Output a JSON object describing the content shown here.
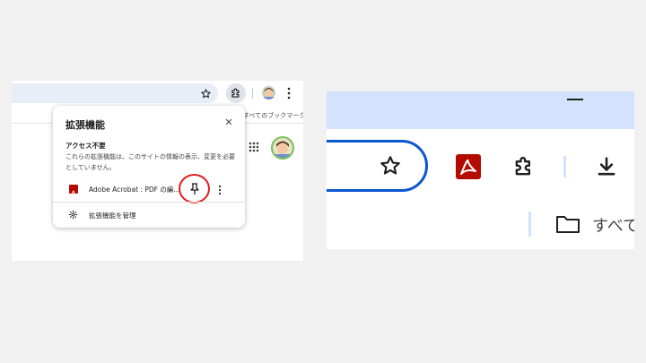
{
  "left_panel": {
    "bookmarks_bar_text": "すべてのブックマーク",
    "icons": [
      "star-icon",
      "puzzle-icon",
      "avatar",
      "more-vert-icon",
      "apps-grid-icon"
    ]
  },
  "extensions_popup": {
    "title": "拡張機能",
    "close_glyph": "✕",
    "section_heading": "アクセス不要",
    "section_description": "これらの拡張機能は、このサイトの情報の表示、変更を必要としていません。",
    "item": {
      "name": "Adobe Acrobat : PDF の編...",
      "icon": "acrobat-icon",
      "pinned": false
    },
    "manage_label": "拡張機能を管理",
    "highlight_color": "#e51c1c"
  },
  "right_panel": {
    "bookmarks_bar_text": "すべて",
    "accent_color": "#0b57d0",
    "titlebar_color": "#d3e3fd",
    "icons": [
      "minimize-icon",
      "star-icon",
      "acrobat-icon",
      "puzzle-icon",
      "download-icon",
      "folder-icon"
    ]
  }
}
